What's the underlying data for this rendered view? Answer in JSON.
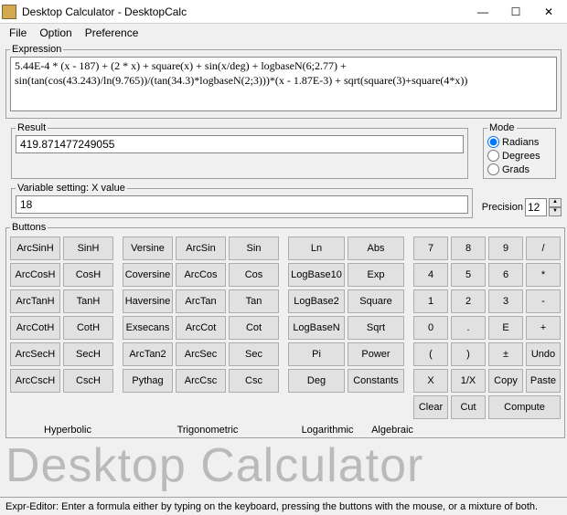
{
  "window": {
    "title": "Desktop Calculator - DesktopCalc",
    "min": "—",
    "max": "☐",
    "close": "✕"
  },
  "menu": {
    "file": "File",
    "option": "Option",
    "preference": "Preference"
  },
  "expression": {
    "legend": "Expression",
    "value": "5.44E-4 * (x - 187) + (2 * x) + square(x) + sin(x/deg) + logbaseN(6;2.77) + sin(tan(cos(43.243)/ln(9.765))/(tan(34.3)*logbaseN(2;3)))*(x - 1.87E-3) + sqrt(square(3)+square(4*x))"
  },
  "result": {
    "legend": "Result",
    "value": "419.871477249055"
  },
  "mode": {
    "legend": "Mode",
    "radians": "Radians",
    "degrees": "Degrees",
    "grads": "Grads",
    "selected": "radians"
  },
  "variable": {
    "legend": "Variable setting: X value",
    "value": "18"
  },
  "precision": {
    "label": "Precision",
    "value": "12"
  },
  "buttons_legend": "Buttons",
  "groups": {
    "hyperbolic": [
      "ArcSinH",
      "SinH",
      "ArcCosH",
      "CosH",
      "ArcTanH",
      "TanH",
      "ArcCotH",
      "CotH",
      "ArcSecH",
      "SecH",
      "ArcCscH",
      "CscH"
    ],
    "trig": [
      "Versine",
      "ArcSin",
      "Sin",
      "Coversine",
      "ArcCos",
      "Cos",
      "Haversine",
      "ArcTan",
      "Tan",
      "Exsecans",
      "ArcCot",
      "Cot",
      "ArcTan2",
      "ArcSec",
      "Sec",
      "Pythag",
      "ArcCsc",
      "Csc"
    ],
    "logalg": [
      "Ln",
      "Abs",
      "LogBase10",
      "Exp",
      "LogBase2",
      "Square",
      "LogBaseN",
      "Sqrt",
      "Pi",
      "Power",
      "Deg",
      "Constants"
    ],
    "numpad": [
      "7",
      "8",
      "9",
      "/",
      "4",
      "5",
      "6",
      "*",
      "1",
      "2",
      "3",
      "-",
      "0",
      ".",
      "E",
      "+",
      "(",
      ")",
      "±",
      "Undo",
      "X",
      "1/X",
      "Copy",
      "Paste",
      "Clear",
      "Cut",
      "",
      "",
      ""
    ]
  },
  "num_extra": {
    "clear": "Clear",
    "cut": "Cut",
    "compute": "Compute"
  },
  "section_labels": {
    "hyperbolic": "Hyperbolic",
    "trig": "Trigonometric",
    "log": "Logarithmic",
    "alg": "Algebraic"
  },
  "bigtitle": "Desktop Calculator",
  "status": "Expr-Editor: Enter a formula either by typing on the keyboard, pressing the buttons with the mouse, or a mixture of both."
}
